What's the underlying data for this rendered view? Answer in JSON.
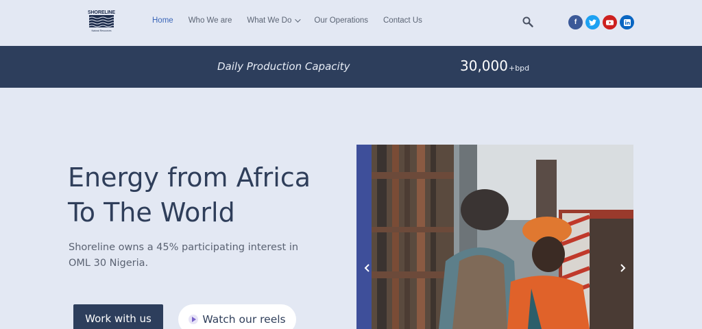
{
  "logo": {
    "name": "SHORELINE",
    "sub": "Natural Resources"
  },
  "nav": {
    "items": [
      {
        "label": "Home",
        "active": true
      },
      {
        "label": "Who We are",
        "active": false
      },
      {
        "label": "What We Do",
        "active": false,
        "dropdown": true
      },
      {
        "label": "Our Operations",
        "active": false
      },
      {
        "label": "Contact Us",
        "active": false
      }
    ]
  },
  "social": [
    "facebook-icon",
    "twitter-icon",
    "youtube-icon",
    "linkedin-icon"
  ],
  "banner": {
    "label": "Daily Production Capacity",
    "value": "30,000",
    "unit": "+bpd"
  },
  "hero": {
    "title_line1": "Energy from Africa",
    "title_line2": "To The World",
    "subtitle": "Shoreline owns a 45% participating interest in OML 30 Nigeria."
  },
  "buttons": {
    "work": "Work with us",
    "reels": "Watch our reels"
  },
  "colors": {
    "navy": "#2d3e5c",
    "accent": "#3b66b8",
    "background": "#e3e8f3"
  }
}
